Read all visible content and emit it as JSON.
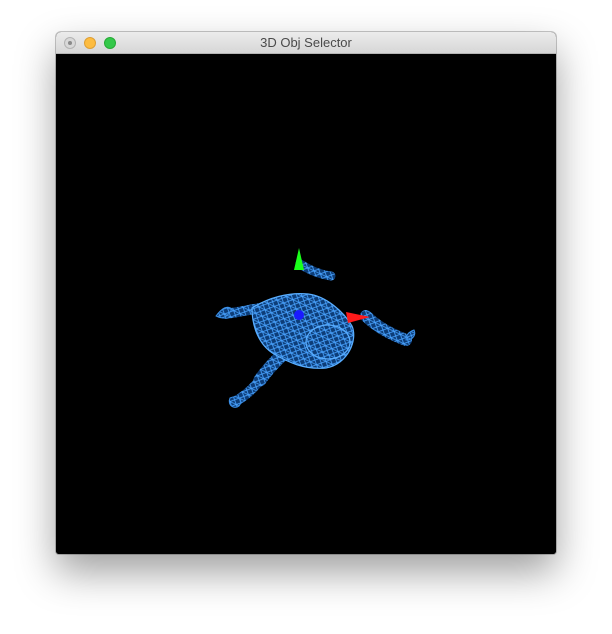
{
  "window": {
    "title": "3D Obj Selector"
  },
  "viewport": {
    "background": "#000000",
    "model": {
      "name": "frog",
      "render_mode": "wireframe",
      "color": "#1e78dc"
    },
    "axes_gizmo": {
      "x_color": "#ff1a1a",
      "y_color": "#1aff1a",
      "z_color": "#1a1aff"
    }
  }
}
